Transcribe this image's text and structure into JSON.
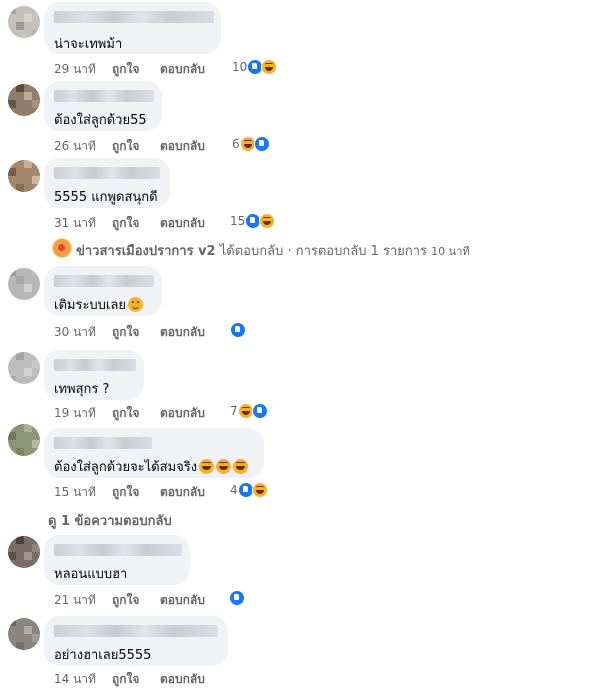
{
  "comments": [
    {
      "text": "น่าจะเทพม้า",
      "time": "29 นาที",
      "like": "ถูกใจ",
      "reply": "ตอบกลับ",
      "reaction_count": "10",
      "reactions": [
        "like-icon",
        "haha-icon"
      ]
    },
    {
      "text": "ต้องใส่ลูกด้วย55",
      "time": "26 นาที",
      "like": "ถูกใจ",
      "reply": "ตอบกลับ",
      "reaction_count": "6",
      "reactions": [
        "haha-icon",
        "like-icon"
      ]
    },
    {
      "text": "5555 แกพูดสนุกดี",
      "time": "31 นาที",
      "like": "ถูกใจ",
      "reply": "ตอบกลับ",
      "reaction_count": "15",
      "reactions": [
        "like-icon",
        "haha-icon"
      ]
    },
    {
      "text": "เติมระบบเลย",
      "emoji": "smile-emoji",
      "time": "30 นาที",
      "like": "ถูกใจ",
      "reply": "ตอบกลับ",
      "reaction_count": "",
      "reactions": [
        "like-icon"
      ]
    },
    {
      "text": "เทพสุกร ?",
      "time": "19 นาที",
      "like": "ถูกใจ",
      "reply": "ตอบกลับ",
      "reaction_count": "7",
      "reactions": [
        "haha-icon",
        "like-icon"
      ]
    },
    {
      "text": "ต้องใส่ลูกด้วยจะได้สมจริง",
      "emoji": "haha-emoji x3",
      "time": "15 นาที",
      "like": "ถูกใจ",
      "reply": "ตอบกลับ",
      "reaction_count": "4",
      "reactions": [
        "like-icon",
        "haha-icon"
      ]
    },
    {
      "text": "หลอนแบบฮา",
      "time": "21 นาที",
      "like": "ถูกใจ",
      "reply": "ตอบกลับ",
      "reaction_count": "",
      "reactions": [
        "like-icon"
      ]
    },
    {
      "text": "อย่างฮาเลย5555",
      "time": "14 นาที",
      "like": "ถูกใจ",
      "reply": "ตอบกลับ",
      "reaction_count": "",
      "reactions": []
    }
  ],
  "page_reply": {
    "page_name": "ข่าวสารเมืองปราการ v2",
    "text": " ได้ตอบกลับ · การตอบกลับ 1 รายการ",
    "time": "10 นาที"
  },
  "view_replies": "ดู 1 ข้อความตอบกลับ",
  "colors": {
    "bubble": "#f0f2f5",
    "meta": "#65676b",
    "like": "#1877f2",
    "haha": "#f7b125"
  }
}
